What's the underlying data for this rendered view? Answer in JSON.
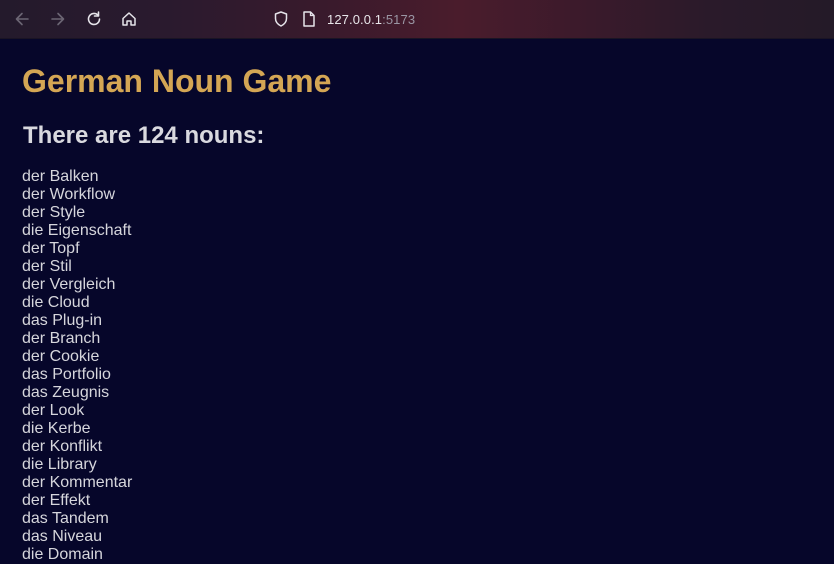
{
  "browser": {
    "url_host": "127.0.0.1",
    "url_port": ":5173"
  },
  "page": {
    "title": "German Noun Game",
    "subtitle": "There are 124 nouns:",
    "nouns": [
      "der Balken",
      "der Workflow",
      "der Style",
      "die Eigenschaft",
      "der Topf",
      "der Stil",
      "der Vergleich",
      "die Cloud",
      "das Plug-in",
      "der Branch",
      "der Cookie",
      "das Portfolio",
      "das Zeugnis",
      "der Look",
      "die Kerbe",
      "der Konflikt",
      "die Library",
      "der Kommentar",
      "der Effekt",
      "das Tandem",
      "das Niveau",
      "die Domain"
    ]
  },
  "colors": {
    "background": "#06062a",
    "title": "#d4a654",
    "text": "#d6d6dc"
  }
}
